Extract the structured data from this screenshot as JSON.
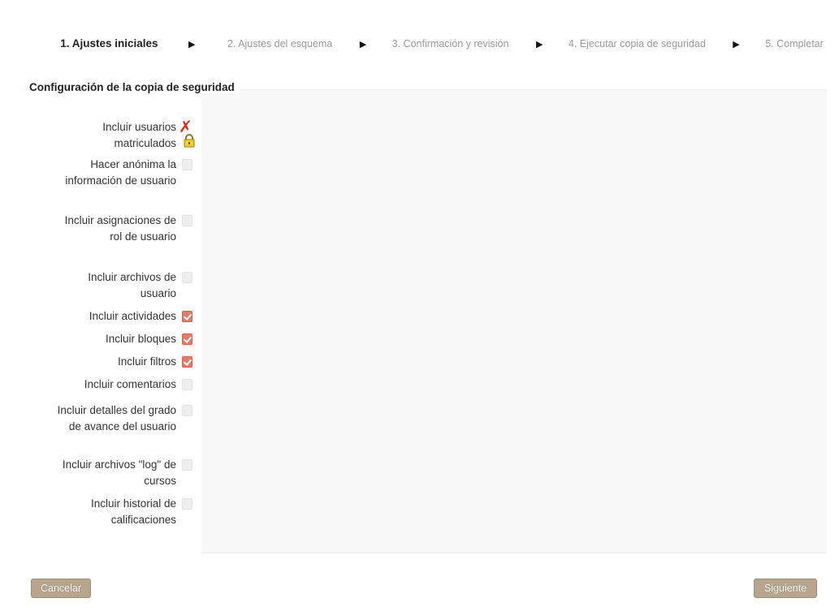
{
  "steps": [
    {
      "label": "1. Ajustes iniciales",
      "current": true
    },
    {
      "label": "2. Ajustes del esquema",
      "current": false
    },
    {
      "label": "3. Confirmación y revisión",
      "current": false
    },
    {
      "label": "4. Ejecutar copia de seguridad",
      "current": false
    },
    {
      "label": "5. Completar",
      "current": false
    }
  ],
  "step_separator_icon": "triangle-right-icon",
  "fieldset": {
    "legend": "Configuración de la copia de seguridad"
  },
  "settings": [
    {
      "label": "Incluir usuarios matriculados",
      "state": "locked-no",
      "icons": [
        "cross-icon",
        "lock-icon"
      ]
    },
    {
      "label": "Hacer anónima la información de usuario",
      "state": "disabled-unchecked"
    },
    {
      "label": "Incluir asignaciones de rol de usuario",
      "state": "disabled-unchecked"
    },
    {
      "label": "Incluir archivos de usuario",
      "state": "disabled-unchecked"
    },
    {
      "label": "Incluir actividades",
      "state": "checked"
    },
    {
      "label": "Incluir bloques",
      "state": "checked"
    },
    {
      "label": "Incluir filtros",
      "state": "checked"
    },
    {
      "label": "Incluir comentarios",
      "state": "disabled-unchecked"
    },
    {
      "label": "Incluir detalles del grado de avance del usuario",
      "state": "disabled-unchecked"
    },
    {
      "label": "Incluir archivos \"log\" de cursos",
      "state": "disabled-unchecked"
    },
    {
      "label": "Incluir historial de calificaciones",
      "state": "disabled-unchecked"
    }
  ],
  "buttons": {
    "cancel": "Cancelar",
    "next": "Siguiente"
  },
  "colors": {
    "button_bg": "#b7a68d",
    "checkbox_checked": "#e37b6b",
    "cross_icon": "#e02b12"
  }
}
